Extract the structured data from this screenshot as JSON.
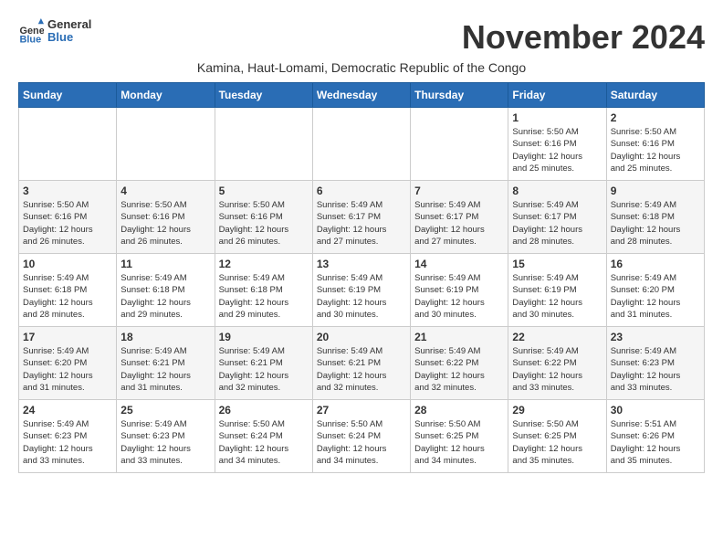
{
  "logo": {
    "line1": "General",
    "line2": "Blue"
  },
  "title": "November 2024",
  "subtitle": "Kamina, Haut-Lomami, Democratic Republic of the Congo",
  "days_header": [
    "Sunday",
    "Monday",
    "Tuesday",
    "Wednesday",
    "Thursday",
    "Friday",
    "Saturday"
  ],
  "weeks": [
    [
      {
        "day": "",
        "info": ""
      },
      {
        "day": "",
        "info": ""
      },
      {
        "day": "",
        "info": ""
      },
      {
        "day": "",
        "info": ""
      },
      {
        "day": "",
        "info": ""
      },
      {
        "day": "1",
        "info": "Sunrise: 5:50 AM\nSunset: 6:16 PM\nDaylight: 12 hours\nand 25 minutes."
      },
      {
        "day": "2",
        "info": "Sunrise: 5:50 AM\nSunset: 6:16 PM\nDaylight: 12 hours\nand 25 minutes."
      }
    ],
    [
      {
        "day": "3",
        "info": "Sunrise: 5:50 AM\nSunset: 6:16 PM\nDaylight: 12 hours\nand 26 minutes."
      },
      {
        "day": "4",
        "info": "Sunrise: 5:50 AM\nSunset: 6:16 PM\nDaylight: 12 hours\nand 26 minutes."
      },
      {
        "day": "5",
        "info": "Sunrise: 5:50 AM\nSunset: 6:16 PM\nDaylight: 12 hours\nand 26 minutes."
      },
      {
        "day": "6",
        "info": "Sunrise: 5:49 AM\nSunset: 6:17 PM\nDaylight: 12 hours\nand 27 minutes."
      },
      {
        "day": "7",
        "info": "Sunrise: 5:49 AM\nSunset: 6:17 PM\nDaylight: 12 hours\nand 27 minutes."
      },
      {
        "day": "8",
        "info": "Sunrise: 5:49 AM\nSunset: 6:17 PM\nDaylight: 12 hours\nand 28 minutes."
      },
      {
        "day": "9",
        "info": "Sunrise: 5:49 AM\nSunset: 6:18 PM\nDaylight: 12 hours\nand 28 minutes."
      }
    ],
    [
      {
        "day": "10",
        "info": "Sunrise: 5:49 AM\nSunset: 6:18 PM\nDaylight: 12 hours\nand 28 minutes."
      },
      {
        "day": "11",
        "info": "Sunrise: 5:49 AM\nSunset: 6:18 PM\nDaylight: 12 hours\nand 29 minutes."
      },
      {
        "day": "12",
        "info": "Sunrise: 5:49 AM\nSunset: 6:18 PM\nDaylight: 12 hours\nand 29 minutes."
      },
      {
        "day": "13",
        "info": "Sunrise: 5:49 AM\nSunset: 6:19 PM\nDaylight: 12 hours\nand 30 minutes."
      },
      {
        "day": "14",
        "info": "Sunrise: 5:49 AM\nSunset: 6:19 PM\nDaylight: 12 hours\nand 30 minutes."
      },
      {
        "day": "15",
        "info": "Sunrise: 5:49 AM\nSunset: 6:19 PM\nDaylight: 12 hours\nand 30 minutes."
      },
      {
        "day": "16",
        "info": "Sunrise: 5:49 AM\nSunset: 6:20 PM\nDaylight: 12 hours\nand 31 minutes."
      }
    ],
    [
      {
        "day": "17",
        "info": "Sunrise: 5:49 AM\nSunset: 6:20 PM\nDaylight: 12 hours\nand 31 minutes."
      },
      {
        "day": "18",
        "info": "Sunrise: 5:49 AM\nSunset: 6:21 PM\nDaylight: 12 hours\nand 31 minutes."
      },
      {
        "day": "19",
        "info": "Sunrise: 5:49 AM\nSunset: 6:21 PM\nDaylight: 12 hours\nand 32 minutes."
      },
      {
        "day": "20",
        "info": "Sunrise: 5:49 AM\nSunset: 6:21 PM\nDaylight: 12 hours\nand 32 minutes."
      },
      {
        "day": "21",
        "info": "Sunrise: 5:49 AM\nSunset: 6:22 PM\nDaylight: 12 hours\nand 32 minutes."
      },
      {
        "day": "22",
        "info": "Sunrise: 5:49 AM\nSunset: 6:22 PM\nDaylight: 12 hours\nand 33 minutes."
      },
      {
        "day": "23",
        "info": "Sunrise: 5:49 AM\nSunset: 6:23 PM\nDaylight: 12 hours\nand 33 minutes."
      }
    ],
    [
      {
        "day": "24",
        "info": "Sunrise: 5:49 AM\nSunset: 6:23 PM\nDaylight: 12 hours\nand 33 minutes."
      },
      {
        "day": "25",
        "info": "Sunrise: 5:49 AM\nSunset: 6:23 PM\nDaylight: 12 hours\nand 33 minutes."
      },
      {
        "day": "26",
        "info": "Sunrise: 5:50 AM\nSunset: 6:24 PM\nDaylight: 12 hours\nand 34 minutes."
      },
      {
        "day": "27",
        "info": "Sunrise: 5:50 AM\nSunset: 6:24 PM\nDaylight: 12 hours\nand 34 minutes."
      },
      {
        "day": "28",
        "info": "Sunrise: 5:50 AM\nSunset: 6:25 PM\nDaylight: 12 hours\nand 34 minutes."
      },
      {
        "day": "29",
        "info": "Sunrise: 5:50 AM\nSunset: 6:25 PM\nDaylight: 12 hours\nand 35 minutes."
      },
      {
        "day": "30",
        "info": "Sunrise: 5:51 AM\nSunset: 6:26 PM\nDaylight: 12 hours\nand 35 minutes."
      }
    ]
  ]
}
